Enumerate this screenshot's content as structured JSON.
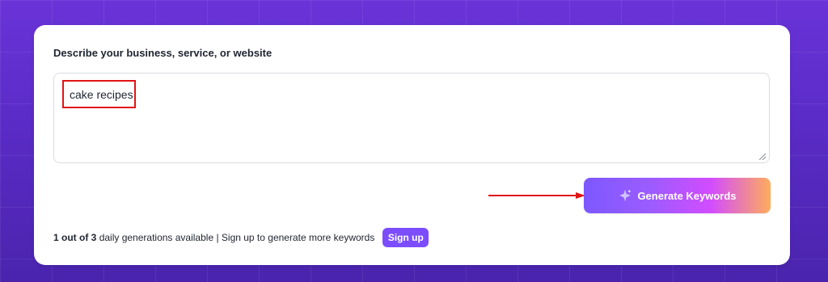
{
  "card": {
    "label": "Describe your business, service, or website",
    "textarea_value": "cake recipes",
    "generate_button_label": "Generate Keywords"
  },
  "footer": {
    "count": "1 out of 3",
    "text": "daily generations available | Sign up to generate more keywords",
    "signup_label": "Sign up"
  },
  "icons": {
    "generate": "sparkles-icon",
    "annotation_arrow": "arrow-right-icon"
  },
  "colors": {
    "background": "#5a2bc6",
    "accent": "#7b4dff",
    "highlight": "#e01414"
  }
}
